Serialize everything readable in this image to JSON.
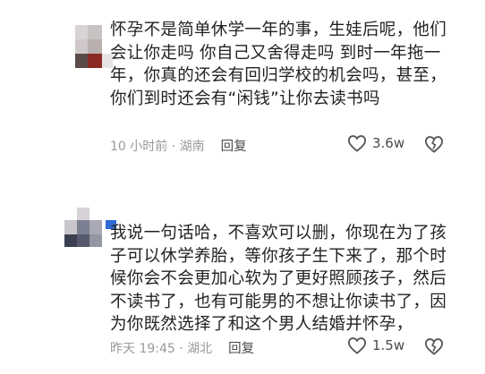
{
  "comments": [
    {
      "text": "怀孕不是简单休学一年的事，生娃后呢，他们\n会让你走吗  你自己又舍得走吗  到时一年拖一\n年，你真的还会有回归学校的机会吗，甚至，\n你们到时还会有“闲钱”让你去读书吗",
      "time_location": "10 小时前 · 湖南",
      "reply_label": "回复",
      "like_count": "3.6w",
      "avatar_colors": [
        "#c8c3c3",
        "#8a2a22",
        "#5a4a48",
        "#d9d4d4"
      ]
    },
    {
      "text": "我说一句话哈，不喜欢可以删，你现在为了孩\n子可以休学养胎，等你孩子生下来了，那个时\n候你会不会更加心软为了更好照顾孩子，然后\n不读书了，也有可能男的不想让你读书了，因\n为你既然选择了和这个男人结婚并怀孕，",
      "time_location": "昨天 19:45 · 湖北",
      "reply_label": "回复",
      "like_count": "1.5w",
      "avatar_colors": [
        "#d6d2d8",
        "#3b4050",
        "#7b7f92",
        "#2f6bd6"
      ]
    }
  ],
  "icons": {
    "like": "heart-outline-icon",
    "dislike": "broken-heart-icon"
  },
  "colors": {
    "text": "#222222",
    "meta": "#9a9a9a",
    "icon": "#555555"
  }
}
